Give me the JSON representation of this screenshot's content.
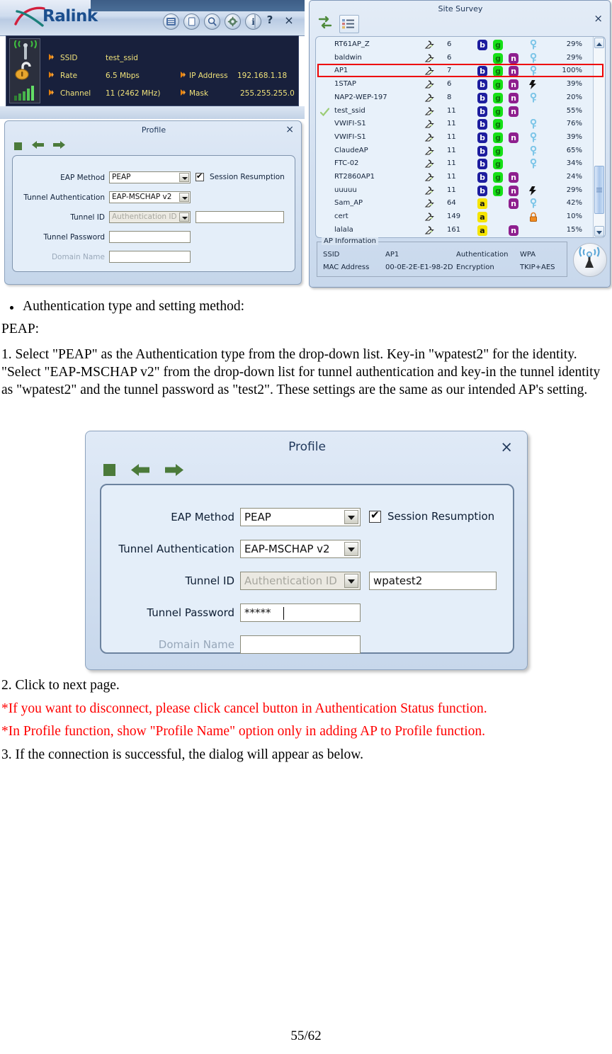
{
  "ralink": {
    "brand": "Ralink",
    "toolbar": [
      {
        "name": "list-view-icon",
        "label": "Profile List"
      },
      {
        "name": "page-icon",
        "label": "Network"
      },
      {
        "name": "magnifier-icon",
        "label": "Site Survey"
      },
      {
        "name": "gear-icon",
        "label": "Advanced"
      },
      {
        "name": "info-icon",
        "label": "About"
      }
    ],
    "help_label": "?",
    "close_label": "×",
    "status": {
      "ssid_label": "SSID",
      "ssid_value": "test_ssid",
      "rate_label": "Rate",
      "rate_value": "6.5 Mbps",
      "channel_label": "Channel",
      "channel_value": "11 (2462 MHz)",
      "ip_label": "IP Address",
      "ip_value": "192.168.1.18",
      "mask_label": "Mask",
      "mask_value": "255.255.255.0"
    }
  },
  "site_survey": {
    "title": "Site Survey",
    "close_label": "×",
    "toolbar": [
      {
        "name": "rescan-icon",
        "label": "Rescan"
      },
      {
        "name": "list-detail-icon",
        "label": "List"
      }
    ],
    "rows": [
      {
        "connected": false,
        "ssid": "RT61AP_Z",
        "channel": "6",
        "bands": [
          "b",
          "g"
        ],
        "secure": "key",
        "signal": "29%"
      },
      {
        "connected": false,
        "ssid": "baldwin",
        "channel": "6",
        "bands": [
          "g",
          "n"
        ],
        "secure": "key",
        "signal": "29%"
      },
      {
        "connected": false,
        "ssid": "AP1",
        "channel": "7",
        "bands": [
          "b",
          "g",
          "n"
        ],
        "secure": "key",
        "signal": "100%",
        "highlight": true
      },
      {
        "connected": false,
        "ssid": "1STAP",
        "channel": "6",
        "bands": [
          "b",
          "g",
          "n"
        ],
        "secure": "wps",
        "signal": "39%"
      },
      {
        "connected": false,
        "ssid": "NAP2-WEP-197",
        "channel": "8",
        "bands": [
          "b",
          "g",
          "n"
        ],
        "secure": "key",
        "signal": "20%"
      },
      {
        "connected": true,
        "ssid": "test_ssid",
        "channel": "11",
        "bands": [
          "b",
          "g",
          "n"
        ],
        "secure": "none",
        "signal": "55%"
      },
      {
        "connected": false,
        "ssid": "VWIFI-S1",
        "channel": "11",
        "bands": [
          "b",
          "g"
        ],
        "secure": "key",
        "signal": "76%"
      },
      {
        "connected": false,
        "ssid": "VWIFI-S1",
        "channel": "11",
        "bands": [
          "b",
          "g",
          "n"
        ],
        "secure": "key",
        "signal": "39%"
      },
      {
        "connected": false,
        "ssid": "ClaudeAP",
        "channel": "11",
        "bands": [
          "b",
          "g"
        ],
        "secure": "key",
        "signal": "65%"
      },
      {
        "connected": false,
        "ssid": "FTC-02",
        "channel": "11",
        "bands": [
          "b",
          "g"
        ],
        "secure": "key",
        "signal": "34%"
      },
      {
        "connected": false,
        "ssid": "RT2860AP1",
        "channel": "11",
        "bands": [
          "b",
          "g",
          "n"
        ],
        "secure": "none",
        "signal": "24%"
      },
      {
        "connected": false,
        "ssid": "uuuuu",
        "channel": "11",
        "bands": [
          "b",
          "g",
          "n"
        ],
        "secure": "wps",
        "signal": "29%"
      },
      {
        "connected": false,
        "ssid": "Sam_AP",
        "channel": "64",
        "bands": [
          "a",
          "n"
        ],
        "secure": "key",
        "signal": "42%"
      },
      {
        "connected": false,
        "ssid": "cert",
        "channel": "149",
        "bands": [
          "a"
        ],
        "secure": "lock",
        "signal": "10%"
      },
      {
        "connected": false,
        "ssid": "lalala",
        "channel": "161",
        "bands": [
          "a",
          "n"
        ],
        "secure": "none",
        "signal": "15%"
      }
    ],
    "ap_information": {
      "legend": "AP Information",
      "ssid_label": "SSID",
      "ssid_value": "AP1",
      "auth_label": "Authentication",
      "auth_value": "WPA",
      "mac_label": "MAC Address",
      "mac_value": "00-0E-2E-E1-98-2D",
      "enc_label": "Encryption",
      "enc_value": "TKIP+AES"
    }
  },
  "profile_small": {
    "title": "Profile",
    "close_label": "×",
    "toolbar": [
      {
        "name": "stop-square-icon",
        "label": "Stop"
      },
      {
        "name": "arrow-left-icon",
        "label": "Back"
      },
      {
        "name": "arrow-right-icon",
        "label": "Next"
      }
    ],
    "eap_method_label": "EAP Method",
    "eap_method_value": "PEAP",
    "session_resumption_label": "Session Resumption",
    "tunnel_auth_label": "Tunnel Authentication",
    "tunnel_auth_value": "EAP-MSCHAP v2",
    "tunnel_id_label": "Tunnel ID",
    "tunnel_id_combo_value": "Authentication ID",
    "tunnel_id_value": "",
    "tunnel_password_label": "Tunnel Password",
    "tunnel_password_value": "",
    "domain_name_label": "Domain Name",
    "domain_name_value": ""
  },
  "profile_large": {
    "title": "Profile",
    "close_label": "×",
    "toolbar": [
      {
        "name": "stop-square-icon",
        "label": "Stop"
      },
      {
        "name": "arrow-left-icon",
        "label": "Back"
      },
      {
        "name": "arrow-right-icon",
        "label": "Next"
      }
    ],
    "eap_method_label": "EAP Method",
    "eap_method_value": "PEAP",
    "session_resumption_label": "Session Resumption",
    "tunnel_auth_label": "Tunnel Authentication",
    "tunnel_auth_value": "EAP-MSCHAP v2",
    "tunnel_id_label": "Tunnel ID",
    "tunnel_id_combo_value": "Authentication ID",
    "tunnel_id_value": "wpatest2",
    "tunnel_password_label": "Tunnel Password",
    "tunnel_password_value": "*****",
    "domain_name_label": "Domain Name",
    "domain_name_value": ""
  },
  "document": {
    "bullet_line": "Authentication type and setting method:",
    "peap_heading": "PEAP:",
    "step1": "1. Select \"PEAP\" as the Authentication type from the drop-down list. Key-in \"wpatest2\" for the identity. \"Select \"EAP-MSCHAP v2\" from the drop-down list for tunnel authentication and key-in the tunnel identity as \"wpatest2\" and the tunnel password as \"test2\". These settings are the same as our intended AP's setting.",
    "step2": "2. Click to next page.",
    "note1": "*If you want to disconnect, please click cancel button in Authentication Status function.",
    "note2": "*In Profile function, show \"Profile Name\" option only in adding AP to Profile function.",
    "step3": "3. If the connection is successful, the dialog will appear as below.",
    "page_number": "55/62"
  }
}
